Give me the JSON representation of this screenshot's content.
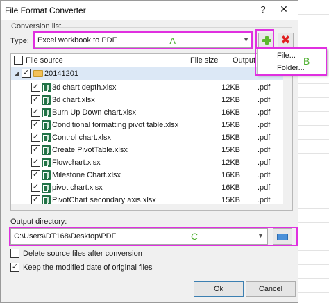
{
  "window": {
    "title": "File Format Converter",
    "help": "?",
    "close": "✕"
  },
  "conversion": {
    "group_label": "Conversion list",
    "type_label": "Type:",
    "type_value": "Excel workbook to PDF",
    "add_icon": "add-icon",
    "delete_icon": "delete-icon"
  },
  "list": {
    "headers": {
      "file_source": "File source",
      "file_size": "File size",
      "output": "Output"
    },
    "folder": {
      "name": "20141201"
    },
    "rows": [
      {
        "name": "3d chart depth.xlsx",
        "size": "12KB",
        "output": ".pdf"
      },
      {
        "name": "3d chart.xlsx",
        "size": "12KB",
        "output": ".pdf"
      },
      {
        "name": "Burn Up Down chart.xlsx",
        "size": "16KB",
        "output": ".pdf"
      },
      {
        "name": "Conditional formatting pivot table.xlsx",
        "size": "15KB",
        "output": ".pdf"
      },
      {
        "name": "Control chart.xlsx",
        "size": "15KB",
        "output": ".pdf"
      },
      {
        "name": "Create PivotTable.xlsx",
        "size": "15KB",
        "output": ".pdf"
      },
      {
        "name": "Flowchart.xlsx",
        "size": "12KB",
        "output": ".pdf"
      },
      {
        "name": "Milestone Chart.xlsx",
        "size": "16KB",
        "output": ".pdf"
      },
      {
        "name": "pivot chart.xlsx",
        "size": "16KB",
        "output": ".pdf"
      },
      {
        "name": "PivotChart secondary axis.xlsx",
        "size": "15KB",
        "output": ".pdf"
      }
    ]
  },
  "add_menu": {
    "items": [
      "File...",
      "Folder..."
    ]
  },
  "output": {
    "label": "Output directory:",
    "path": "C:\\Users\\DT168\\Desktop\\PDF",
    "browse_icon": "folder-icon"
  },
  "options": {
    "delete_source": {
      "label": "Delete source files after conversion",
      "checked": false
    },
    "keep_date": {
      "label": "Keep the modified date of original files",
      "checked": true
    }
  },
  "buttons": {
    "ok": "Ok",
    "cancel": "Cancel"
  },
  "annotations": {
    "a": "A",
    "b": "B",
    "c": "C"
  },
  "colors": {
    "highlight": "#e030e0",
    "annotation_letter": "#4caf2e",
    "excel_green": "#217346",
    "add_green": "#5cb82e",
    "delete_red": "#e02020"
  }
}
